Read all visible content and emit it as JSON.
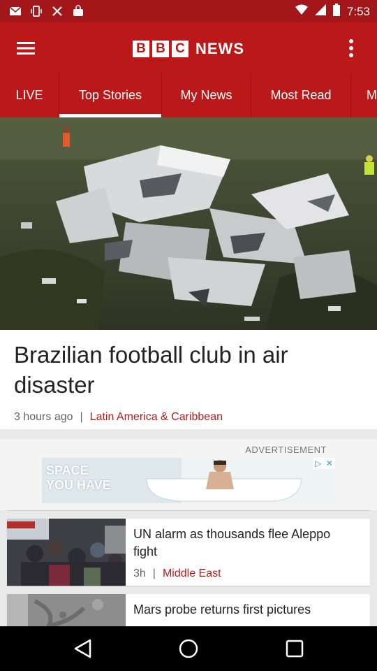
{
  "status": {
    "time": "7:53",
    "left_icons": [
      "mail-icon",
      "vibrate-icon",
      "tools-icon",
      "bag-icon"
    ],
    "right_icons": [
      "wifi-icon",
      "signal-icon",
      "battery-icon"
    ]
  },
  "appbar": {
    "logo_letters": [
      "B",
      "B",
      "C"
    ],
    "logo_word": "NEWS",
    "menu_icon": "hamburger-menu-icon",
    "overflow_icon": "more-vert-icon",
    "color": "#bb1919"
  },
  "tabs": [
    {
      "label": "LIVE",
      "active": false
    },
    {
      "label": "Top Stories",
      "active": true
    },
    {
      "label": "My News",
      "active": false
    },
    {
      "label": "Most Read",
      "active": false
    },
    {
      "label": "M",
      "active": false
    }
  ],
  "lead_story": {
    "headline": "Brazilian football club in air disaster",
    "time": "3 hours ago",
    "separator": "|",
    "section": "Latin America & Caribbean"
  },
  "ad": {
    "label": "ADVERTISEMENT",
    "banner_text": "SPACE\nYOU HAVE",
    "icons": [
      "play-triangle-icon",
      "close-icon"
    ]
  },
  "stories": [
    {
      "title": "UN alarm as thousands flee Aleppo fight",
      "time": "3h",
      "separator": "|",
      "section": "Middle East"
    },
    {
      "title": "Mars probe returns first pictures"
    }
  ],
  "navbar": {
    "icons": [
      "back-icon",
      "home-icon",
      "recents-icon"
    ]
  },
  "colors": {
    "brand_red": "#bb1919",
    "status_red": "#a3171b",
    "section_red": "#bb1919"
  }
}
